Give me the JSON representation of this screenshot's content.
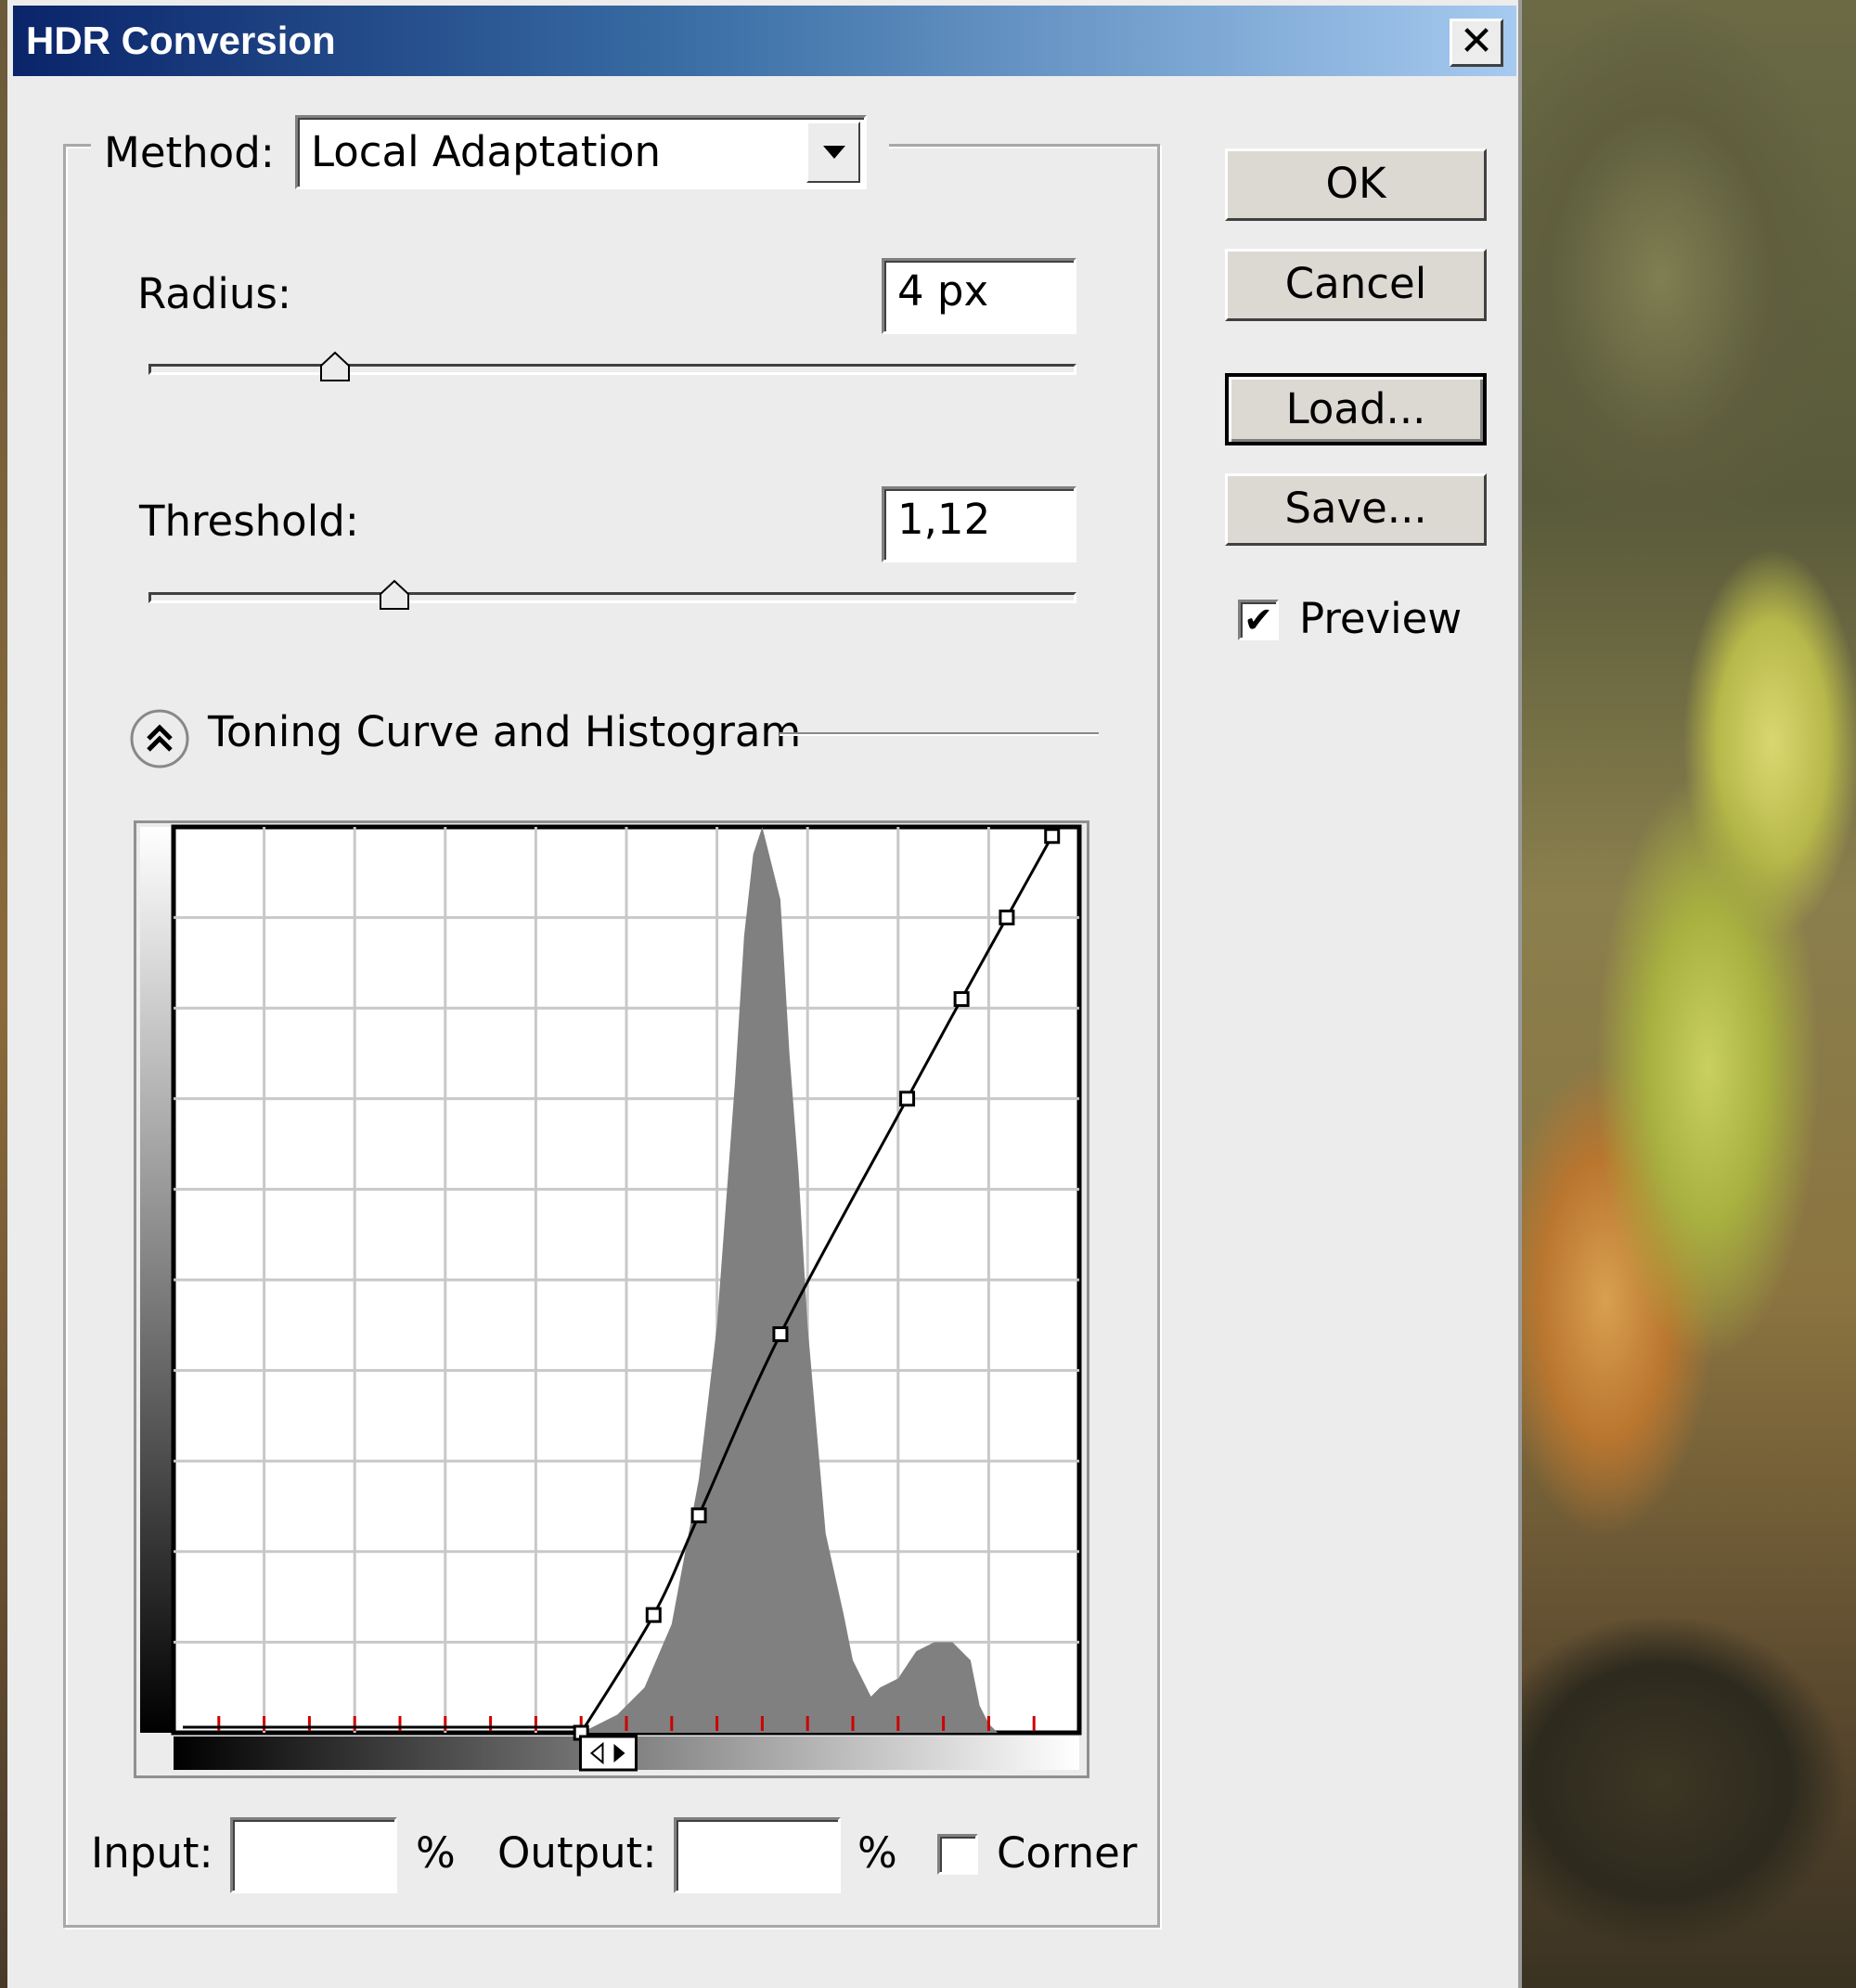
{
  "window": {
    "title": "HDR Conversion",
    "close_glyph": "✕"
  },
  "method": {
    "label": "Method:",
    "value": "Local Adaptation",
    "dropdown_icon": "chevron-down-icon"
  },
  "radius": {
    "label": "Radius:",
    "value": "4 px",
    "slider_level": 0.2
  },
  "threshold": {
    "label": "Threshold:",
    "value": "1,12",
    "slider_level": 0.26
  },
  "toning": {
    "section_label": "Toning Curve and Histogram",
    "collapse_icon": "double-chevron-up-icon"
  },
  "curve_editor": {
    "input_label": "Input:",
    "input_value": "",
    "input_unit": "%",
    "output_label": "Output:",
    "output_value": "",
    "output_unit": "%",
    "corner_label": "Corner",
    "corner_checked": false
  },
  "buttons": {
    "ok": "OK",
    "cancel": "Cancel",
    "load": "Load...",
    "save": "Save..."
  },
  "preview": {
    "label": "Preview",
    "checked": true,
    "check_glyph": "✔"
  },
  "colors": {
    "title_bar_start": "#0a246a",
    "title_bar_end": "#a6caf0",
    "dialog_bg": "#ececec",
    "histogram_fill": "#808080",
    "tick_marks": "#cc0000"
  },
  "chart_data": {
    "type": "area",
    "xlim": [
      0,
      100
    ],
    "ylim": [
      0,
      100
    ],
    "grid": true,
    "histogram": {
      "x": [
        45,
        49,
        52,
        55,
        58,
        60,
        62,
        63,
        64,
        65,
        66,
        67,
        68,
        69,
        70,
        72,
        74,
        75,
        77,
        78,
        80,
        82,
        84,
        86,
        88,
        89,
        90,
        91,
        92,
        93,
        94,
        96
      ],
      "y": [
        0,
        2,
        5,
        12,
        28,
        45,
        72,
        88,
        97,
        100,
        96,
        92,
        75,
        62,
        45,
        22,
        13,
        8,
        4,
        5,
        6,
        9,
        10,
        10,
        8,
        3,
        1,
        0,
        0,
        0,
        0,
        0
      ]
    },
    "curve_points": {
      "x": [
        45,
        53,
        58,
        67,
        81,
        87,
        92,
        97
      ],
      "y": [
        0,
        13,
        24,
        44,
        70,
        81,
        90,
        99
      ]
    },
    "black_point": 48
  }
}
